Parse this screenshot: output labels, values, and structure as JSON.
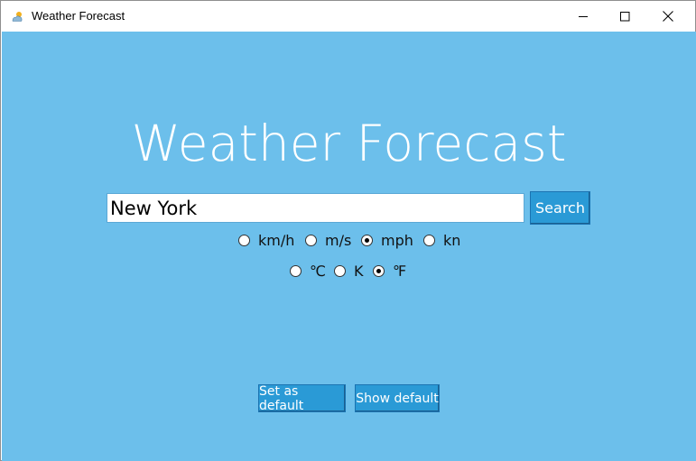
{
  "window": {
    "title": "Weather Forecast",
    "icon": "weather-app-icon",
    "controls": [
      "minimize-icon",
      "maximize-icon",
      "close-icon"
    ]
  },
  "main": {
    "heading": "Weather Forecast",
    "search": {
      "value": "New York",
      "placeholder": "",
      "button_label": "Search"
    },
    "speed_units": {
      "options": [
        "km/h",
        "m/s",
        "mph",
        "kn"
      ],
      "selected": "mph"
    },
    "temperature_units": {
      "options": [
        "℃",
        "K",
        "℉"
      ],
      "selected": "℉"
    },
    "actions": {
      "set_default_label": "Set as default",
      "show_default_label": "Show default"
    }
  },
  "colors": {
    "background": "#6cbfeb",
    "button": "#2a9ad6",
    "heading_text": "#ffffff"
  }
}
